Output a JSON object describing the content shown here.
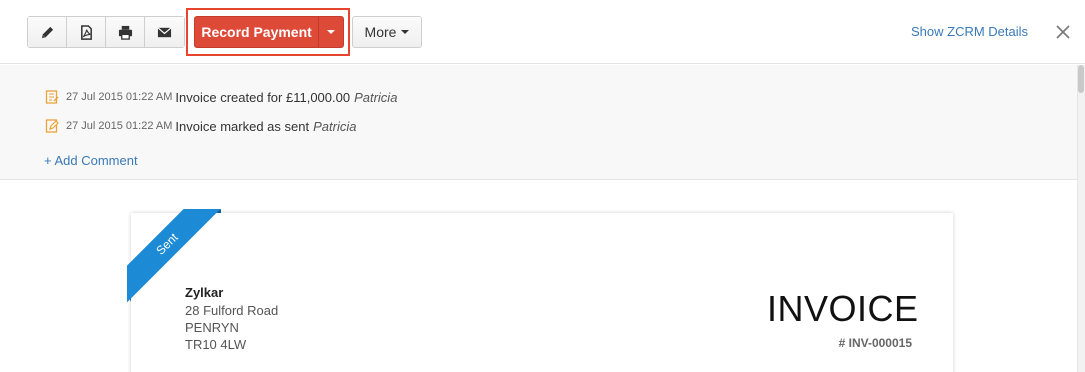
{
  "toolbar": {
    "icon_buttons": [
      {
        "name": "edit-icon"
      },
      {
        "name": "pdf-icon"
      },
      {
        "name": "print-icon"
      },
      {
        "name": "email-icon"
      }
    ],
    "record_payment_label": "Record Payment",
    "more_label": "More",
    "zcrm_link": "Show ZCRM Details",
    "close_icon": "close-icon"
  },
  "history": [
    {
      "time": "27 Jul 2015 01:22 AM",
      "text": "Invoice created for £11,000.00",
      "user": "Patricia"
    },
    {
      "time": "27 Jul 2015 01:22 AM",
      "text": "Invoice marked as sent",
      "user": "Patricia"
    }
  ],
  "add_comment_label": "+ Add Comment",
  "invoice": {
    "status_ribbon": "Sent",
    "org_name": "Zylkar",
    "address": [
      "28 Fulford Road",
      "PENRYN",
      "TR10 4LW"
    ],
    "title": "INVOICE",
    "number": "# INV-000015"
  },
  "colors": {
    "accent_red": "#dd4a38",
    "link_blue": "#3a7ab8",
    "ribbon_blue": "#1c8ad4",
    "history_icon_orange": "#e8a33a"
  }
}
